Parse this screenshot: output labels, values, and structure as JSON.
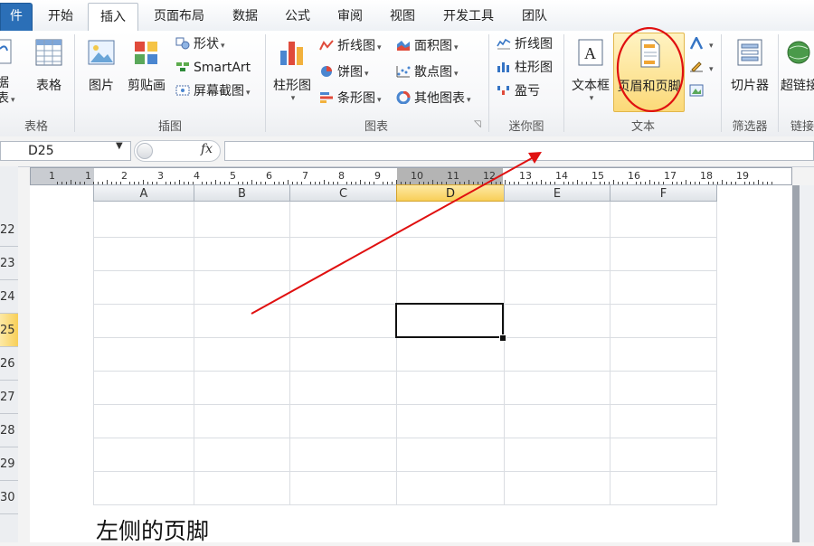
{
  "tabs": {
    "file": "件",
    "items": [
      "开始",
      "插入",
      "页面布局",
      "数据",
      "公式",
      "审阅",
      "视图",
      "开发工具",
      "团队"
    ],
    "active_index": 1
  },
  "ribbon": {
    "table_group": {
      "label": "表格",
      "partial_btn_line1": "据",
      "partial_btn_line2": "表",
      "table_btn": "表格"
    },
    "illustrations": {
      "label": "插图",
      "picture": "图片",
      "clipart": "剪贴画",
      "shapes": "形状",
      "smartart": "SmartArt",
      "screenshot": "屏幕截图"
    },
    "charts": {
      "label": "图表",
      "column": "柱形图",
      "line": "折线图",
      "pie": "饼图",
      "bar": "条形图",
      "area": "面积图",
      "scatter": "散点图",
      "other": "其他图表"
    },
    "sparklines": {
      "label": "迷你图",
      "line": "折线图",
      "column": "柱形图",
      "winloss": "盈亏"
    },
    "text": {
      "label": "文本",
      "textbox": "文本框",
      "header_footer": "页眉和页脚"
    },
    "filter": {
      "label": "筛选器",
      "slicer": "切片器"
    },
    "links": {
      "label": "链接",
      "hyperlink": "超链接"
    }
  },
  "formula_bar": {
    "name_box": "D25",
    "fx": "fx",
    "value": ""
  },
  "ruler": {
    "numbers": [
      "1",
      "1",
      "2",
      "3",
      "4",
      "5",
      "6",
      "7",
      "8",
      "9",
      "10",
      "11",
      "12",
      "13",
      "14",
      "15",
      "16",
      "17",
      "18",
      "19"
    ]
  },
  "sheet": {
    "columns": [
      "A",
      "B",
      "C",
      "D",
      "E",
      "F"
    ],
    "selected_column": "D",
    "rows": [
      "22",
      "23",
      "24",
      "25",
      "26",
      "27",
      "28",
      "29",
      "30"
    ],
    "selected_row": "25",
    "footer_text": "左侧的页脚"
  },
  "colors": {
    "accent": "#2b6fb7",
    "annotation": "#e01010",
    "selected_header": "#f8cf58"
  }
}
